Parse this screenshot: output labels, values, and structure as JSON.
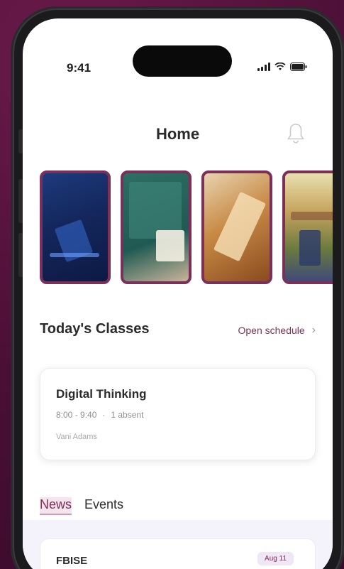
{
  "status_bar": {
    "time": "9:41"
  },
  "header": {
    "title": "Home",
    "bell_icon": "bell-icon"
  },
  "carousel": {
    "items": [
      {
        "name": "story-1",
        "accent": "#1d3b7c"
      },
      {
        "name": "story-2",
        "accent": "#2e6e64"
      },
      {
        "name": "story-3",
        "accent": "#c88a45"
      },
      {
        "name": "story-4",
        "accent": "#c7a45e"
      }
    ]
  },
  "classes": {
    "title": "Today's Classes",
    "open_schedule_label": "Open schedule",
    "card": {
      "title": "Digital Thinking",
      "meta_time": "8:00 - 9:40",
      "meta_extra": "1 absent",
      "teacher": "Vani Adams"
    }
  },
  "tabs": {
    "news_label": "News",
    "events_label": "Events"
  },
  "news": {
    "title": "FBISE",
    "badge": "Aug 11"
  },
  "colors": {
    "brand": "#7c2f58",
    "background": "#4a0f35"
  }
}
